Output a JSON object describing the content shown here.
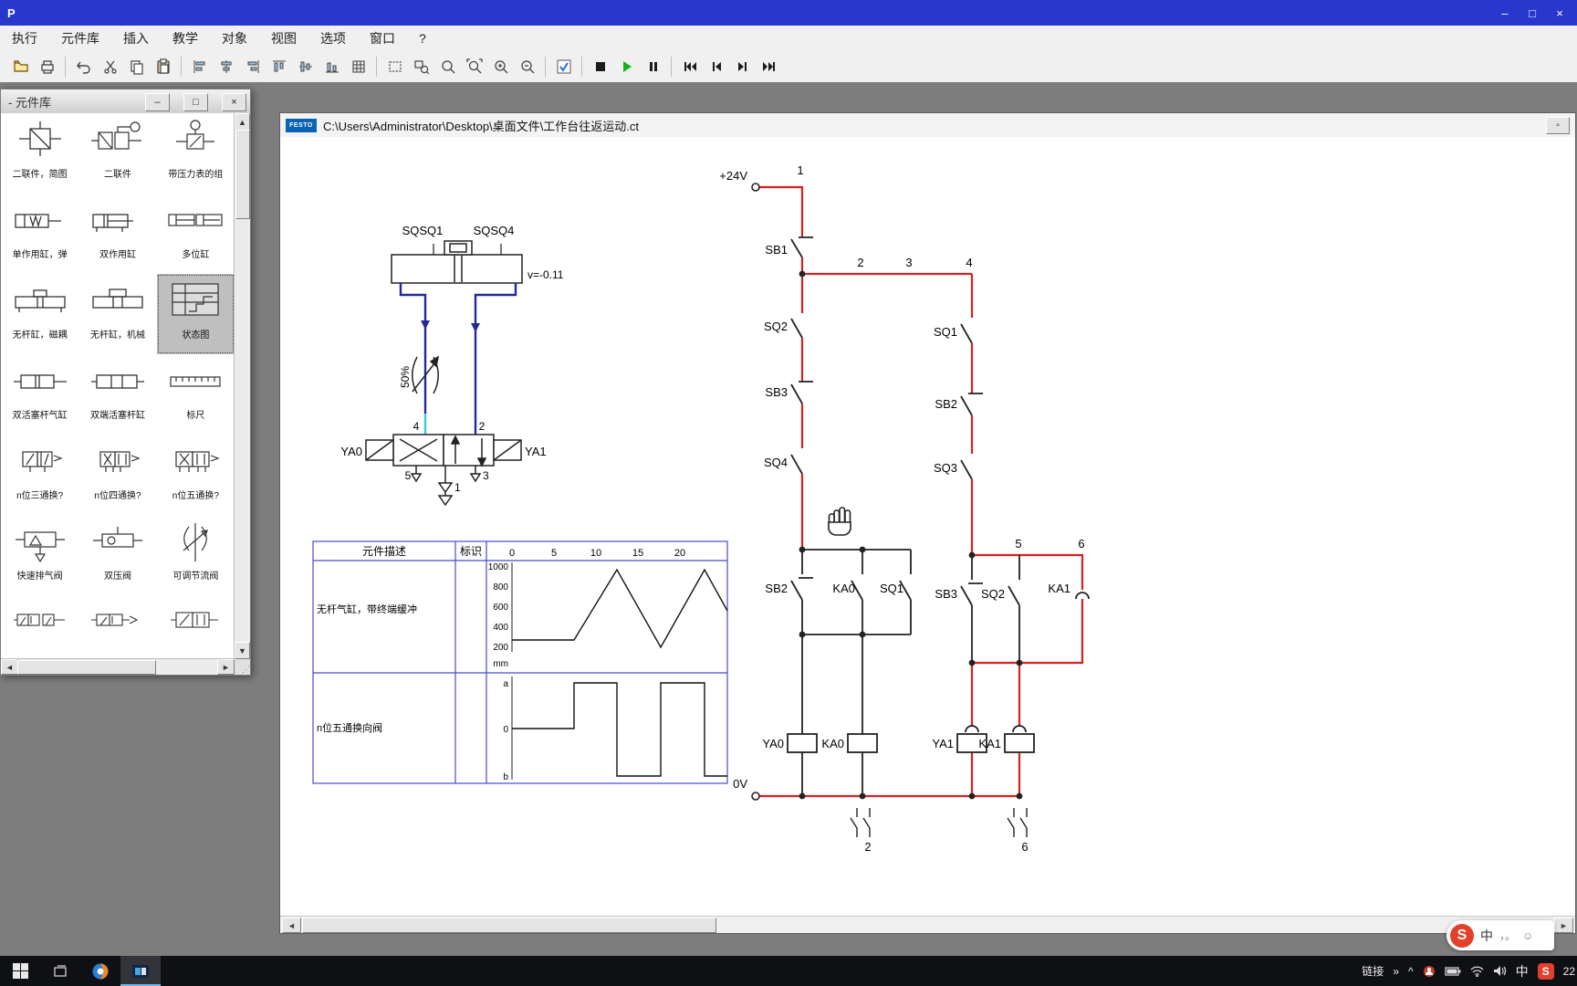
{
  "window": {
    "title": "P"
  },
  "menu": {
    "items": [
      "执行",
      "元件库",
      "插入",
      "教学",
      "对象",
      "视图",
      "选项",
      "窗口",
      "?"
    ]
  },
  "toolbar": {
    "icons": [
      "open",
      "print",
      "undo",
      "cut",
      "copy",
      "paste",
      "align-left",
      "align-center",
      "align-right",
      "align-top",
      "align-middle",
      "align-bottom",
      "grid",
      "zoom-rect",
      "zoom-detail",
      "zoom-100",
      "zoom-fit",
      "zoom-in",
      "zoom-out",
      "check-mode",
      "stop",
      "play",
      "pause",
      "skip-start",
      "step-back",
      "step-forward",
      "skip-end"
    ]
  },
  "library": {
    "title": "- 元件库",
    "items": [
      {
        "label": "二联件，简图"
      },
      {
        "label": "二联件"
      },
      {
        "label": "带压力表的组"
      },
      {
        "label": "单作用缸，弹"
      },
      {
        "label": "双作用缸"
      },
      {
        "label": "多位缸"
      },
      {
        "label": "无杆缸，磁耦"
      },
      {
        "label": "无杆缸，机械"
      },
      {
        "label": "状态图"
      },
      {
        "label": "双活塞杆气缸"
      },
      {
        "label": "双端活塞杆缸"
      },
      {
        "label": "标尺"
      },
      {
        "label": "n位三通换?"
      },
      {
        "label": "n位四通换?"
      },
      {
        "label": "n位五通换?"
      },
      {
        "label": "快速排气阀"
      },
      {
        "label": "双压阀"
      },
      {
        "label": "可调节流阀"
      },
      {
        "label": ""
      },
      {
        "label": ""
      },
      {
        "label": ""
      }
    ]
  },
  "document": {
    "logo": "FESTO",
    "title": "C:\\Users\\Administrator\\Desktop\\桌面文件\\工作台往返运动.ct"
  },
  "pneumatic": {
    "sqsq1": "SQSQ1",
    "sqsq4": "SQSQ4",
    "velocity": "v=-0.11",
    "throttle": "50%",
    "ya0": "YA0",
    "ya1": "YA1",
    "p4": "4",
    "p2": "2",
    "p5": "5",
    "p1": "1",
    "p3": "3"
  },
  "state_table": {
    "col_desc": "元件描述",
    "col_id": "标识",
    "ticks": [
      "0",
      "5",
      "10",
      "15",
      "20"
    ],
    "row1_desc": "无杆气缸，带终端缓冲",
    "row1_yticks": [
      "1000",
      "800",
      "600",
      "400",
      "200"
    ],
    "row1_unit": "mm",
    "row2_desc": "n位五通换向阀",
    "row2_levels": [
      "a",
      "0",
      "b"
    ],
    "position_points": "560,700 628,700 675,623 723,708 771,623 796,668",
    "valve_points": "560,797 628,797 628,747 675,747 675,849 723,849 723,747 771,747 771,849 796,849"
  },
  "ladder": {
    "vplus": "+24V",
    "vzero": "0V",
    "c1": "1",
    "c2": "2",
    "c3": "3",
    "c4": "4",
    "c5": "5",
    "c6": "6",
    "sb1": "SB1",
    "sq2": "SQ2",
    "sb3": "SB3",
    "sq4": "SQ4",
    "sb2": "SB2",
    "ka0": "KA0",
    "sq1": "SQ1",
    "r_sq1": "SQ1",
    "r_sb2": "SB2",
    "r_sq3": "SQ3",
    "r_sb3": "SB3",
    "r_sq2": "SQ2",
    "r_ka1": "KA1",
    "ya0": "YA0",
    "ka0_coil": "KA0",
    "ya1": "YA1",
    "ka1_coil": "KA1",
    "ref_left": "2",
    "ref_right": "6"
  },
  "taskbar": {
    "link": "链接",
    "ime": "中",
    "sogou": "S",
    "time": "22"
  },
  "imebar": {
    "logo": "S",
    "lang": "中",
    "punct": "，。",
    "face": "☺"
  }
}
